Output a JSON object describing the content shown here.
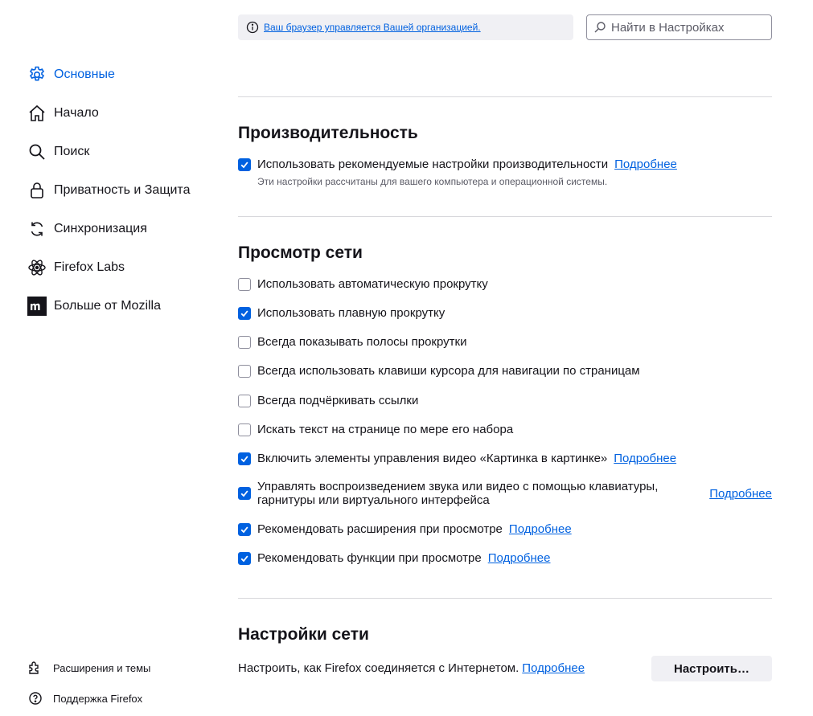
{
  "colors": {
    "accent": "#0061e0",
    "text": "#15141a",
    "muted": "#5b5b66",
    "divider": "#d7d7db"
  },
  "sidebar": {
    "items": [
      {
        "label": "Основные",
        "icon": "gear-icon",
        "active": true
      },
      {
        "label": "Начало",
        "icon": "home-icon"
      },
      {
        "label": "Поиск",
        "icon": "search-icon"
      },
      {
        "label": "Приватность и Защита",
        "icon": "lock-icon"
      },
      {
        "label": "Синхронизация",
        "icon": "sync-icon"
      },
      {
        "label": "Firefox Labs",
        "icon": "labs-icon"
      },
      {
        "label": "Больше от Mozilla",
        "icon": "mozilla-icon"
      }
    ],
    "footer": [
      {
        "label": "Расширения и темы",
        "icon": "puzzle-icon"
      },
      {
        "label": "Поддержка Firefox",
        "icon": "help-icon"
      }
    ]
  },
  "topbar": {
    "policy_text": "Ваш браузер управляется Вашей организацией.",
    "search_placeholder": "Найти в Настройках"
  },
  "performance": {
    "title": "Производительность",
    "recommended": {
      "label": "Использовать рекомендуемые настройки производительности",
      "checked": true,
      "link": "Подробнее"
    },
    "note": "Эти настройки рассчитаны для вашего компьютера и операционной системы."
  },
  "browsing": {
    "title": "Просмотр сети",
    "options": [
      {
        "label": "Использовать автоматическую прокрутку",
        "checked": false
      },
      {
        "label": "Использовать плавную прокрутку",
        "checked": true
      },
      {
        "label": "Всегда показывать полосы прокрутки",
        "checked": false
      },
      {
        "label": "Всегда использовать клавиши курсора для навигации по страницам",
        "checked": false
      },
      {
        "label": "Всегда подчёркивать ссылки",
        "checked": false
      },
      {
        "label": "Искать текст на странице по мере его набора",
        "checked": false
      },
      {
        "label": "Включить элементы управления видео «Картинка в картинке»",
        "checked": true,
        "link": "Подробнее"
      },
      {
        "label_line1": "Управлять воспроизведением звука или видео с помощью клавиатуры,",
        "label_line2": "гарнитуры или виртуального интерфейса",
        "checked": true,
        "link": "Подробнее"
      },
      {
        "label": "Рекомендовать расширения при просмотре",
        "checked": true,
        "link": "Подробнее"
      },
      {
        "label": "Рекомендовать функции при просмотре",
        "checked": true,
        "link": "Подробнее"
      }
    ]
  },
  "network": {
    "title": "Настройки сети",
    "description": "Настроить, как Firefox соединяется с Интернетом.",
    "link": "Подробнее",
    "button": "Настроить…"
  }
}
